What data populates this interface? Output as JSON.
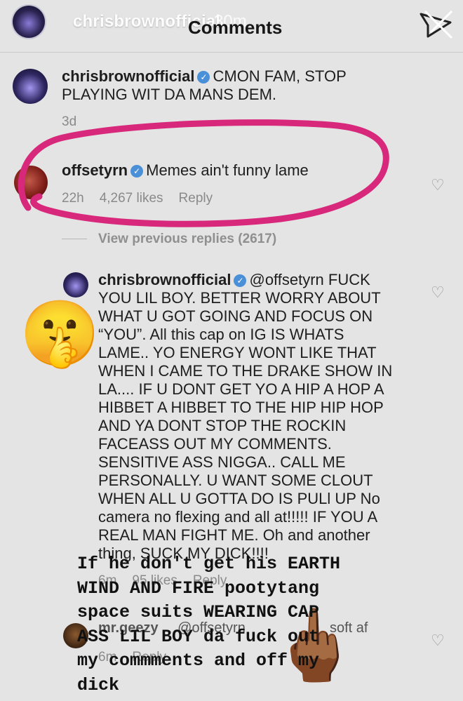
{
  "story": {
    "username": "chrisbrownofficial",
    "time": "30m",
    "title": "Comments",
    "close_icon": "close-x-icon"
  },
  "comments": [
    {
      "username": "chrisbrownofficial",
      "verified": true,
      "text_lines": [
        "CMON FAM, STOP",
        "PLAYING WIT DA MANS DEM."
      ],
      "time": "3d"
    },
    {
      "username": "offsetyrn",
      "verified": true,
      "text": "Memes ain't funny lame",
      "time": "22h",
      "likes": "4,267 likes",
      "reply_label": "Reply"
    }
  ],
  "view_previous": "View previous replies (2617)",
  "reply_main": {
    "username": "chrisbrownofficial",
    "mention": "@offsetyrn",
    "first_line_tail": "FUCK",
    "lines": [
      "YOU LIL BOY. BETTER WORRY ABOUT",
      "WHAT U GOT GOING AND FOCUS ON",
      "“YOU”. All this cap on IG IS WHATS",
      "LAME.. YO ENERGY WONT LIKE THAT",
      "WHEN I CAME TO THE DRAKE SHOW IN",
      "LA.... IF U DONT  GET YO A HIP A HOP A",
      "HIBBET A HIBBET TO THE HIP HIP HOP",
      "AND YA DONT STOP THE ROCKIN",
      "FACEASS OUT MY COMMENTS.",
      "SENSITIVE ASS NIGGA.. CALL ME",
      "PERSONALLY. U WANT SOME CLOUT",
      "WHEN ALL U GOTTA DO IS PULl UP No",
      "camera no flexing and all at!!!!! IF YOU A",
      "REAL MAN FIGHT ME. Oh and another",
      "thing, SUCK MY DICK!!!!"
    ],
    "time": "6m",
    "likes": "95 likes",
    "reply_label": "Reply"
  },
  "reply_second": {
    "username": "mr.geezy",
    "mention": "@offsetyrn",
    "text_tail": "soft af",
    "time": "6m",
    "reply_label": "Reply"
  },
  "overlay_text": [
    "If he don't get his EARTH",
    "WIND AND FIRE pootytang",
    "space suits WEARING CAP",
    "ASS  LIL BOY da fuck out",
    "my commments and off my",
    "dick"
  ],
  "emoji": {
    "shush": "🤫",
    "middle_finger": "🖕🏾"
  },
  "colors": {
    "circle": "#d8287b",
    "verified": "#4a90d9"
  }
}
